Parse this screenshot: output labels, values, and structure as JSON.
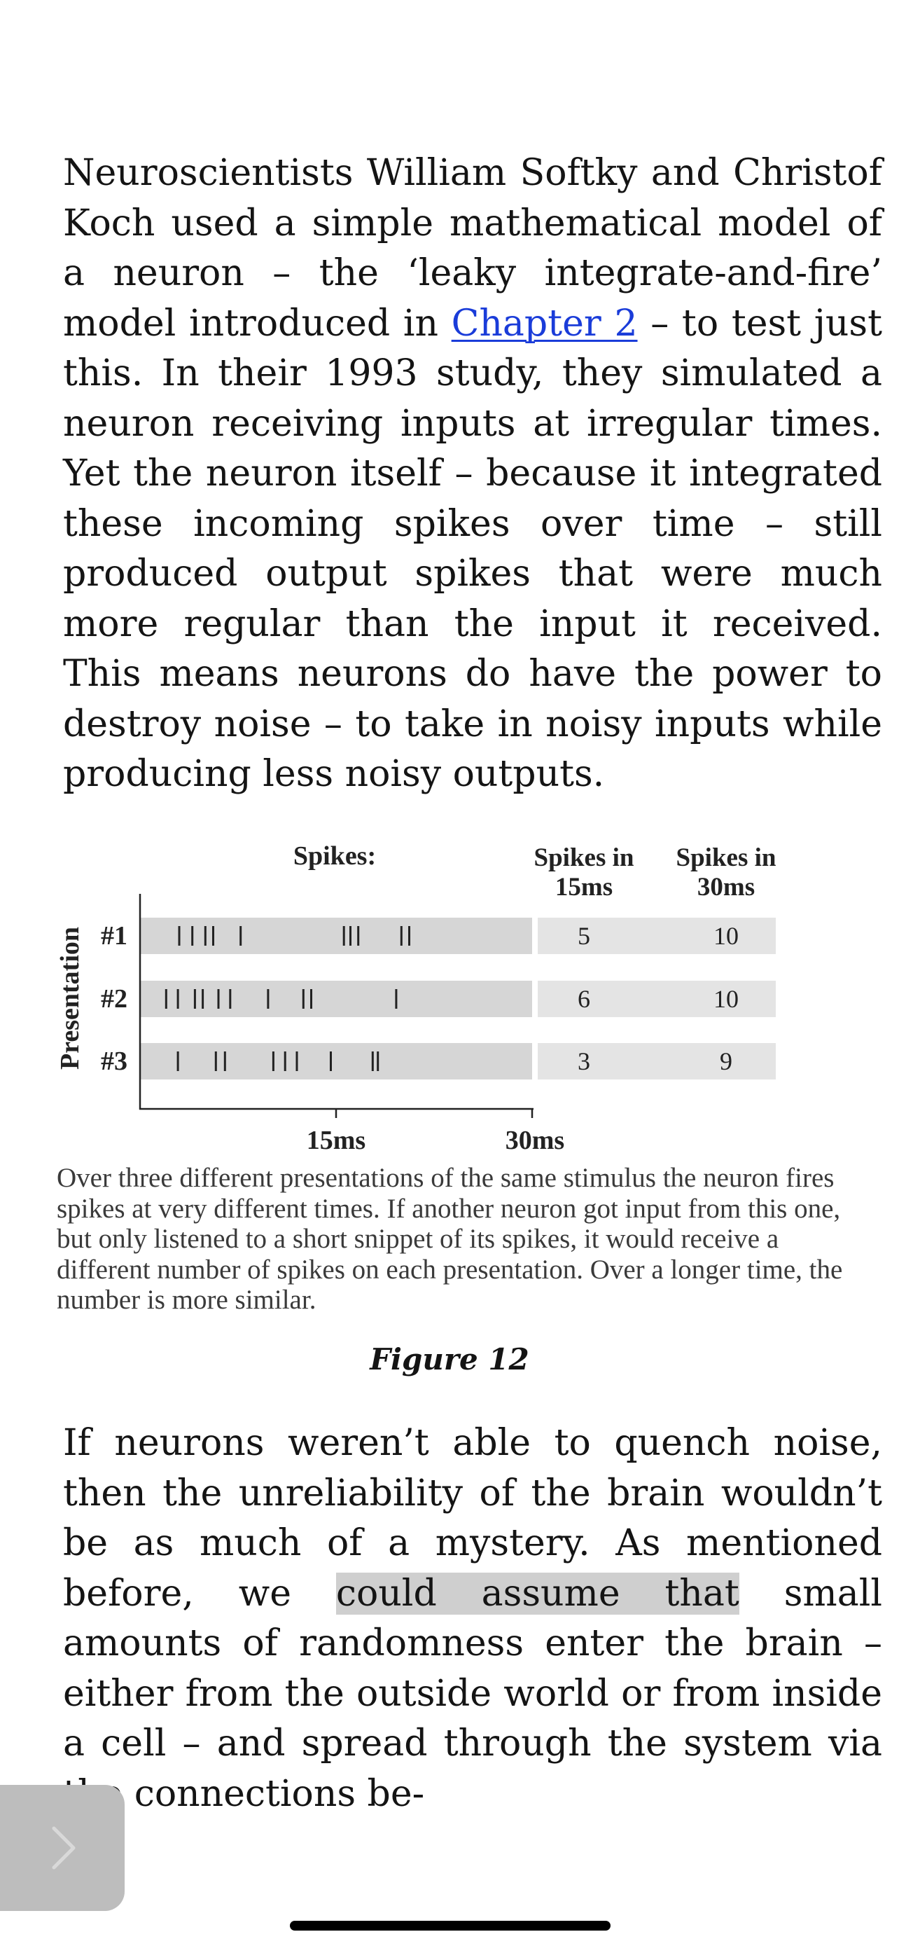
{
  "reader": {
    "paragraph1": {
      "before_link": "Neuroscientists William Softky and Christof Koch used a simple mathematical model of a neuron – the ‘leaky integrate-and-fire’ model introduced in ",
      "link": "Chapter 2",
      "after_link": " – to test just this. In their 1993 study, they simulated a neuron receiving inputs at irregular times. Yet the neuron itself – because it integrated these in­coming spikes over time – still produced out­put spikes that were much more regular than the input it received. This means neurons do have the power to destroy noise – to take in noisy inputs while producing less noisy out­puts."
    },
    "paragraph2": {
      "before_highlight": "If neurons weren’t able to quench noise, then the unreliability of the brain wouldn’t be as much of a mystery. As mentioned before, we ",
      "highlight": "could assume that",
      "after_highlight": " small amounts of random­ness enter the brain – either from the out­side world or from inside a cell – and spread through the system via the connections be-"
    },
    "figure_label": "Figure 12",
    "next_button": {
      "icon": "chevron-right-icon"
    }
  },
  "chart_data": {
    "type": "table",
    "title": "Spikes:",
    "y_axis_label": "Presentation",
    "x_ticks": [
      "15ms",
      "30ms"
    ],
    "x_range_ms": [
      0,
      30
    ],
    "columns": [
      "Spikes in 15ms",
      "Spikes in 30ms"
    ],
    "column_headers": [
      [
        "Spikes in",
        "15ms"
      ],
      [
        "Spikes in",
        "30ms"
      ]
    ],
    "rows": [
      {
        "label": "#1",
        "spike_times_ms": [
          3.0,
          4.0,
          5.0,
          5.6,
          7.7,
          15.6,
          16.1,
          16.7,
          20.0,
          20.6
        ],
        "spikes_in_15ms": "5",
        "spikes_in_30ms": "10"
      },
      {
        "label": "#2",
        "spike_times_ms": [
          2.0,
          2.9,
          4.2,
          4.8,
          6.0,
          6.9,
          9.8,
          12.5,
          13.1,
          19.6
        ],
        "spikes_in_15ms": "6",
        "spikes_in_30ms": "10"
      },
      {
        "label": "#3",
        "spike_times_ms": [
          2.9,
          5.8,
          6.5,
          10.2,
          11.1,
          12.0,
          14.6,
          17.8,
          18.2
        ],
        "spikes_in_15ms": "3",
        "spikes_in_30ms": "9"
      }
    ],
    "caption": "Over three different presentations of the same stimulus the neuron fires spikes at very different times. If another neuron got input from this one, but only listened to a short snippet of its spikes, it would receive a different number of spikes on each presentation. Over a longer time, the number is more similar.",
    "colors": {
      "spike_band": "#d6d6d6",
      "count_band": "#e4e4e4",
      "ink": "#222222"
    }
  }
}
